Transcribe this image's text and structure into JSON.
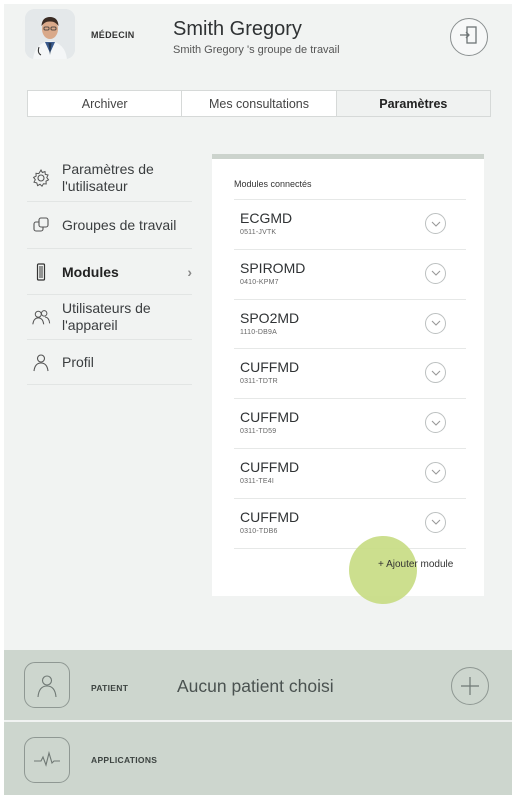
{
  "header": {
    "role": "MÉDECIN",
    "user_name": "Smith Gregory",
    "group": "Smith Gregory 's groupe de travail"
  },
  "tabs": [
    {
      "label": "Archiver"
    },
    {
      "label": "Mes consultations"
    },
    {
      "label": "Paramètres",
      "active": true
    }
  ],
  "sidebar": {
    "items": [
      {
        "label": "Paramètres de l'utilisateur",
        "icon": "gear-icon"
      },
      {
        "label": "Groupes de travail",
        "icon": "groups-icon"
      },
      {
        "label": "Modules",
        "icon": "module-icon",
        "active": true
      },
      {
        "label": "Utilisateurs de l'appareil",
        "icon": "users-icon"
      },
      {
        "label": "Profil",
        "icon": "person-icon"
      }
    ]
  },
  "modules": {
    "title": "Modules connectés",
    "items": [
      {
        "name": "ECGMD",
        "id": "0511-JVTK"
      },
      {
        "name": "SPIROMD",
        "id": "0410-KPM7"
      },
      {
        "name": "SPO2MD",
        "id": "1110-DB9A"
      },
      {
        "name": "CUFFMD",
        "id": "0311-TDTR"
      },
      {
        "name": "CUFFMD",
        "id": "0311-TD59"
      },
      {
        "name": "CUFFMD",
        "id": "0311-TE4I"
      },
      {
        "name": "CUFFMD",
        "id": "0310-TDB6"
      }
    ],
    "add_label": "+ Ajouter module"
  },
  "patient_bar": {
    "label": "PATIENT",
    "status": "Aucun patient choisi"
  },
  "apps_bar": {
    "label": "APPLICATIONS"
  },
  "colors": {
    "background": "#f1f3f2",
    "bottom_bar": "#cdd6ce",
    "highlight": "#c8dc84"
  }
}
